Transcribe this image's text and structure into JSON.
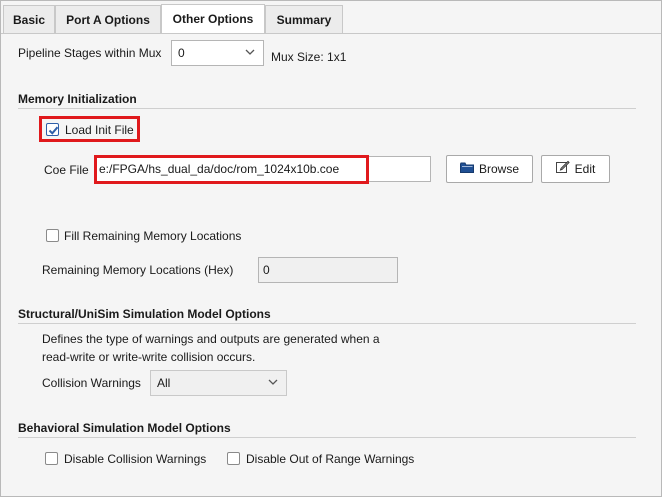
{
  "tabs": [
    {
      "label": "Basic"
    },
    {
      "label": "Port A Options"
    },
    {
      "label": "Other Options"
    },
    {
      "label": "Summary"
    }
  ],
  "pipeline": {
    "label": "Pipeline Stages within Mux",
    "value": "0",
    "mux_size": "Mux Size: 1x1"
  },
  "memory_init": {
    "title": "Memory Initialization",
    "load_init_label": "Load Init File",
    "load_init_checked": true,
    "coe_label": "Coe File",
    "coe_value": "e:/FPGA/hs_dual_da/doc/rom_1024x10b.coe",
    "browse_label": "Browse",
    "edit_label": "Edit",
    "fill_label": "Fill Remaining Memory Locations",
    "fill_checked": false,
    "remaining_label": "Remaining Memory Locations (Hex)",
    "remaining_value": "0"
  },
  "structural": {
    "title": "Structural/UniSim Simulation Model Options",
    "desc_line1": "Defines the type of warnings and outputs are generated when a",
    "desc_line2": "read-write or write-write collision occurs.",
    "collision_label": "Collision Warnings",
    "collision_value": "All"
  },
  "behavioral": {
    "title": "Behavioral Simulation Model Options",
    "disable_collision_label": "Disable Collision Warnings",
    "disable_range_label": "Disable Out of Range Warnings"
  },
  "colors": {
    "highlight": "#e0191c",
    "check": "#2f5fa8"
  }
}
